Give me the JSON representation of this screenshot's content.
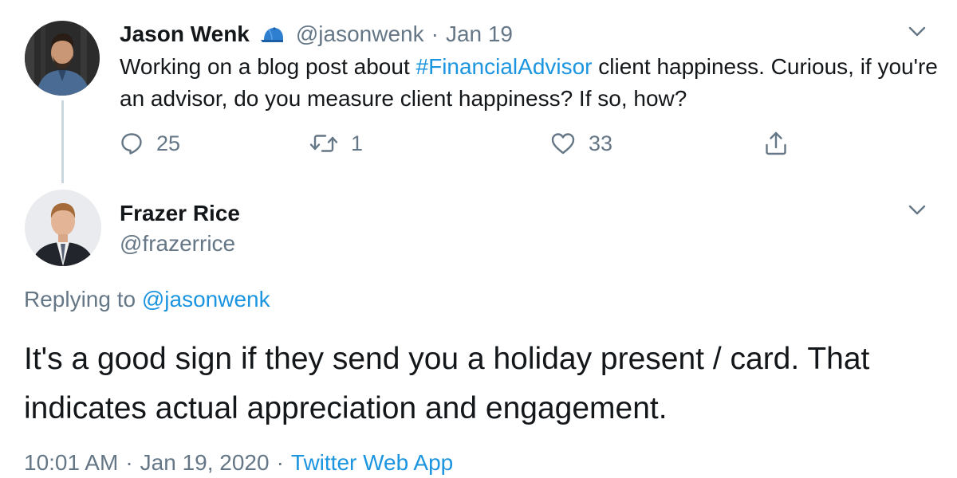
{
  "parent_tweet": {
    "display_name": "Jason Wenk",
    "badge_icon": "baseball-cap-icon",
    "handle": "@jasonwenk",
    "separator": "·",
    "date": "Jan 19",
    "text_before": "Working on a blog post about ",
    "hashtag": "#FinancialAdvisor",
    "text_after": " client happiness. Curious, if you're an advisor, do you measure client happiness? If so, how?",
    "actions": {
      "reply_count": "25",
      "retweet_count": "1",
      "like_count": "33"
    }
  },
  "reply_tweet": {
    "display_name": "Frazer Rice",
    "handle": "@frazerrice",
    "replying_to_label": "Replying to ",
    "replying_to_handle": "@jasonwenk",
    "text": "It's a good sign if they send you a holiday present / card. That indicates actual appreciation and engagement.",
    "time": "10:01 AM",
    "separator": "·",
    "date": "Jan 19, 2020",
    "source": "Twitter Web App"
  },
  "colors": {
    "link": "#1b95e0",
    "secondary_text": "#657786",
    "primary_text": "#14171a",
    "thread_line": "#ccd6dd"
  }
}
